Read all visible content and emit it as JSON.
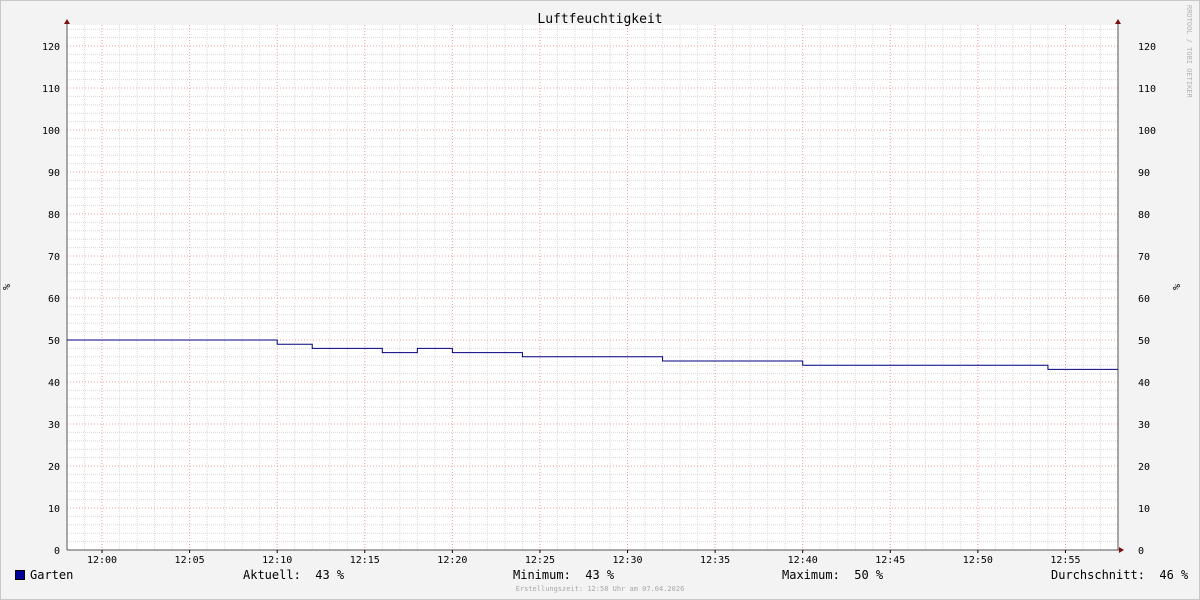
{
  "chart_data": {
    "type": "line",
    "title": "Luftfeuchtigkeit",
    "ylabel": "%",
    "ylim": [
      0,
      125
    ],
    "yticks": [
      0,
      10,
      20,
      30,
      40,
      50,
      60,
      70,
      80,
      90,
      100,
      110,
      120
    ],
    "x_time_range": [
      "11:58",
      "12:58"
    ],
    "xtick_labels": [
      "12:00",
      "12:05",
      "12:10",
      "12:15",
      "12:20",
      "12:25",
      "12:30",
      "12:35",
      "12:40",
      "12:45",
      "12:50",
      "12:55"
    ],
    "grid": true,
    "step": true,
    "series": [
      {
        "name": "Garten",
        "color": "#000080",
        "x": [
          "11:58",
          "12:10",
          "12:12",
          "12:16",
          "12:18",
          "12:20",
          "12:24",
          "12:32",
          "12:40",
          "12:54",
          "12:58"
        ],
        "values": [
          50,
          49,
          48,
          47,
          48,
          47,
          46,
          45,
          44,
          43,
          43
        ]
      }
    ]
  },
  "legend": {
    "series_name": "Garten",
    "swatch_color": "#000099",
    "current_label": "Aktuell:",
    "current_value": "43 %",
    "min_label": "Minimum:",
    "min_value": "43 %",
    "max_label": "Maximum:",
    "max_value": "50 %",
    "avg_label": "Durchschnitt:",
    "avg_value": "46 %"
  },
  "footer_text": "Erstellungszeit: 12:58 Uhr am 07.04.2026",
  "side_text": "RRDTOOL / TOBI OETIKER"
}
